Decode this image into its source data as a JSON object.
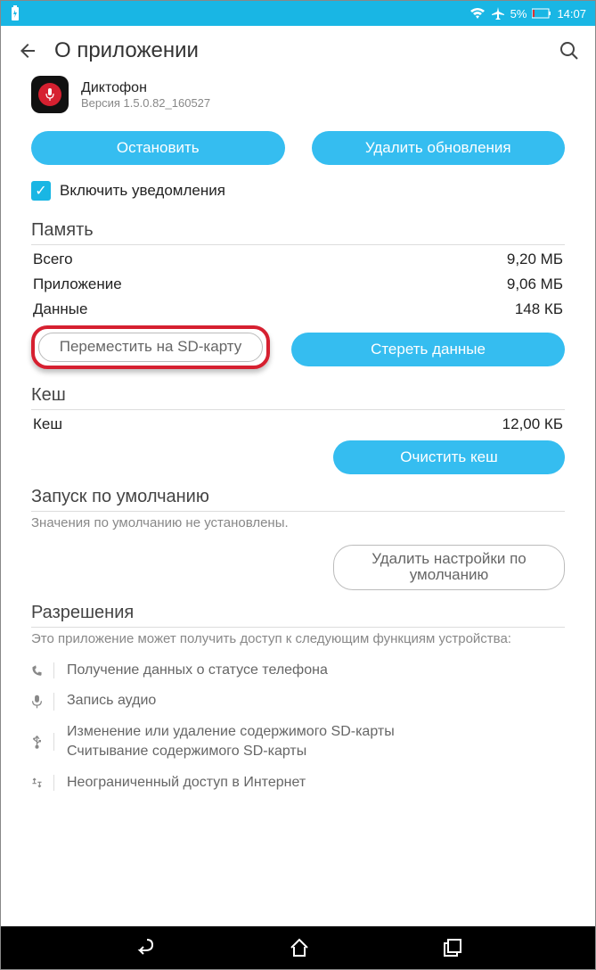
{
  "status": {
    "battery_pct": "5%",
    "time": "14:07"
  },
  "header": {
    "title": "О приложении"
  },
  "app": {
    "name": "Диктофон",
    "version": "Версия 1.5.0.82_160527"
  },
  "buttons": {
    "stop": "Остановить",
    "uninstall_updates": "Удалить обновления",
    "move_to_sd": "Переместить на SD-карту",
    "clear_data": "Стереть данные",
    "clear_cache": "Очистить кеш",
    "clear_defaults": "Удалить настройки по умолчанию"
  },
  "checkbox": {
    "notifications": "Включить уведомления"
  },
  "sections": {
    "memory": {
      "title": "Память",
      "total_label": "Всего",
      "total_value": "9,20 МБ",
      "app_label": "Приложение",
      "app_value": "9,06 МБ",
      "data_label": "Данные",
      "data_value": "148 КБ"
    },
    "cache": {
      "title": "Кеш",
      "cache_label": "Кеш",
      "cache_value": "12,00 КБ"
    },
    "defaults": {
      "title": "Запуск по умолчанию",
      "subtitle": "Значения по умолчанию не установлены."
    },
    "permissions": {
      "title": "Разрешения",
      "subtitle": "Это приложение может получить доступ к следующим функциям устройства:",
      "items": [
        "Получение данных о статусе телефона",
        "Запись аудио",
        "Изменение или удаление содержимого SD-карты\nСчитывание содержимого SD-карты",
        "Неограниченный доступ в Интернет"
      ]
    }
  }
}
